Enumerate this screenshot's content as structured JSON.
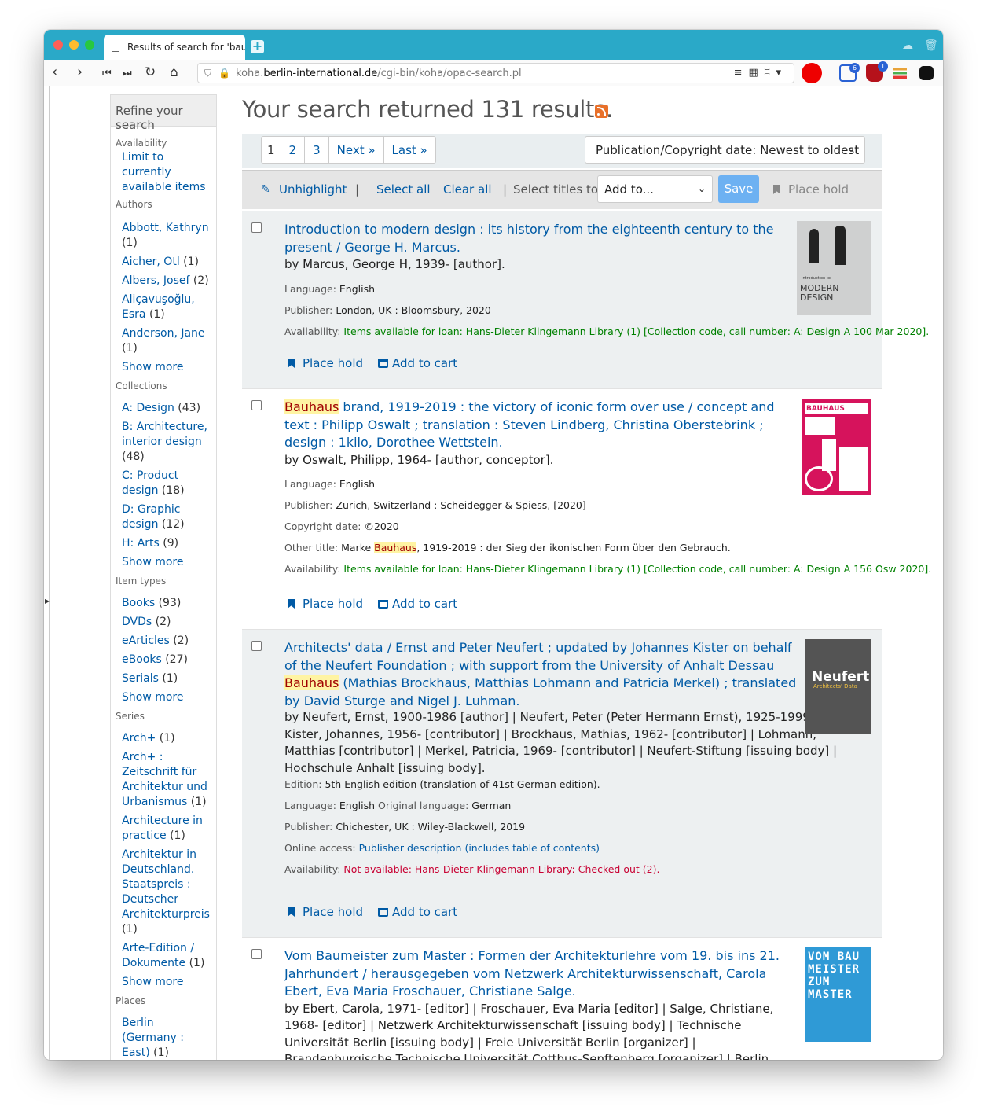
{
  "browser": {
    "tab_title": "Results of search for 'bau",
    "url_host_pre": "koha.",
    "url_domain": "berlin-international.de",
    "url_path": "/cgi-bin/koha/opac-search.pl",
    "ext_badge_1": "6",
    "ext_badge_2": "1"
  },
  "sidebar": {
    "title": "Refine your search",
    "sections": {
      "availability": "Availability",
      "authors": "Authors",
      "collections": "Collections",
      "item_types": "Item types",
      "series": "Series",
      "places": "Places"
    },
    "availability_item": "Limit to currently available items",
    "authors": [
      {
        "name": "Abbott, Kathryn",
        "count": "(1)"
      },
      {
        "name": "Aicher, Otl",
        "count": "(1)"
      },
      {
        "name": "Albers, Josef",
        "count": "(2)"
      },
      {
        "name": "Aliçavuşoğlu, Esra",
        "count": "(1)"
      },
      {
        "name": "Anderson, Jane",
        "count": "(1)"
      }
    ],
    "collections": [
      {
        "name": "A: Design",
        "count": "(43)"
      },
      {
        "name": "B: Architecture, interior design",
        "count": "(48)"
      },
      {
        "name": "C: Product design",
        "count": "(18)"
      },
      {
        "name": "D: Graphic design",
        "count": "(12)"
      },
      {
        "name": "H: Arts",
        "count": "(9)"
      }
    ],
    "item_types": [
      {
        "name": "Books",
        "count": "(93)"
      },
      {
        "name": "DVDs",
        "count": "(2)"
      },
      {
        "name": "eArticles",
        "count": "(2)"
      },
      {
        "name": "eBooks",
        "count": "(27)"
      },
      {
        "name": "Serials",
        "count": "(1)"
      }
    ],
    "series": [
      {
        "name": "Arch+",
        "count": "(1)"
      },
      {
        "name": "Arch+ : Zeitschrift für Architektur und Urbanismus",
        "count": "(1)"
      },
      {
        "name": "Architecture in practice",
        "count": "(1)"
      },
      {
        "name": "Architektur in Deutschland. Staatspreis : Deutscher Architekturpreis",
        "count": "(1)"
      },
      {
        "name": "Arte-Edition / Dokumente",
        "count": "(1)"
      }
    ],
    "places": [
      {
        "name": "Berlin (Germany : East)",
        "count": "(1)"
      }
    ],
    "show_more": "Show more"
  },
  "main": {
    "heading": "Your search returned 131 results.",
    "pager": {
      "p1": "1",
      "p2": "2",
      "p3": "3",
      "next": "Next »",
      "last": "Last »"
    },
    "sort": "Publication/Copyright date: Newest to oldest",
    "toolbar": {
      "unhighlight": "Unhighlight",
      "select_all": "Select all",
      "clear_all": "Clear all",
      "select_titles": "Select titles to:",
      "add_to": "Add to...",
      "save": "Save",
      "place_hold": "Place hold",
      "sep": "|"
    }
  },
  "labels": {
    "language": "Language:",
    "original_language": "Original language:",
    "publisher": "Publisher:",
    "copyright": "Copyright date:",
    "other_title": "Other title:",
    "availability": "Availability:",
    "edition": "Edition:",
    "online_access": "Online access:",
    "place_hold": "Place hold",
    "add_to_cart": "Add to cart"
  },
  "results": [
    {
      "title": "Introduction to modern design : its history from the eighteenth century to the present / George H. Marcus.",
      "author": "by Marcus, George H, 1939- [author].",
      "language": "English",
      "publisher": "London, UK : Bloomsbury, 2020",
      "availability": "Items available for loan: Hans-Dieter Klingemann Library (1) [Collection code, call number: A: Design A 100 Mar 2020].",
      "cover_top": "Introduction to",
      "cover_big": "MODERN DESIGN"
    },
    {
      "title_hl": "Bauhaus",
      "title_rest": " brand, 1919-2019 : the victory of iconic form over use / concept and text : Philipp Oswalt ; translation : Steven Lindberg, Christina Oberstebrink ; design : 1kilo, Dorothee Wettstein.",
      "author": "by Oswalt, Philipp, 1964- [author, conceptor].",
      "language": "English",
      "publisher": "Zurich, Switzerland : Scheidegger & Spiess, [2020]",
      "copyright": "©2020",
      "other_title_pre": "Marke ",
      "other_title_hl": "Bauhaus",
      "other_title_post": ", 1919-2019 : der Sieg der ikonischen Form über den Gebrauch.",
      "availability": "Items available for loan: Hans-Dieter Klingemann Library (1) [Collection code, call number: A: Design A 156 Osw 2020].",
      "cover_text": "BAUHAUS"
    },
    {
      "title_pre": "Architects' data / Ernst and Peter Neufert ; updated by Johannes Kister on behalf of the Neufert Foundation ; with support from the University of Anhalt Dessau ",
      "title_hl": "Bauhaus",
      "title_post": " (Mathias Brockhaus, Matthias Lohmann and Patricia Merkel) ; translated by David Sturge and Nigel J. Luhman.",
      "author": "by Neufert, Ernst, 1900-1986 [author] | Neufert, Peter (Peter Hermann Ernst), 1925-1999 [author] | Kister, Johannes, 1956- [contributor] | Brockhaus, Mathias, 1962- [contributor] | Lohmann, Matthias [contributor] | Merkel, Patricia, 1969- [contributor] | Neufert-Stiftung [issuing body] | Hochschule Anhalt [issuing body].",
      "edition": "5th English edition (translation of 41st German edition).",
      "language": "English",
      "original_language": "German",
      "publisher": "Chichester, UK : Wiley-Blackwell, 2019",
      "online_access": "Publisher description (includes table of contents)",
      "availability": "Not available: Hans-Dieter Klingemann Library: Checked out (2).",
      "cover_big": "Neufert",
      "cover_small": "Architects' Data"
    },
    {
      "title": "Vom Baumeister zum Master : Formen der Architekturlehre vom 19. bis ins 21. Jahrhundert / herausgegeben vom Netzwerk Architekturwissenschaft, Carola Ebert, Eva Maria Froschauer, Christiane Salge.",
      "author": "by Ebert, Carola, 1971- [editor] | Froschauer, Eva Maria [editor] | Salge, Christiane, 1968- [editor] | Netzwerk Architekturwissenschaft [issuing body] | Technische Universität Berlin [issuing body] | Freie Universität Berlin [organizer] | Brandenburgische Technische Universität Cottbus-Senftenberg [organizer] | Berlin International University of Applied Sciences [organizer]",
      "cover_text": "VOM BAU MEISTER ZUM MASTER"
    }
  ]
}
